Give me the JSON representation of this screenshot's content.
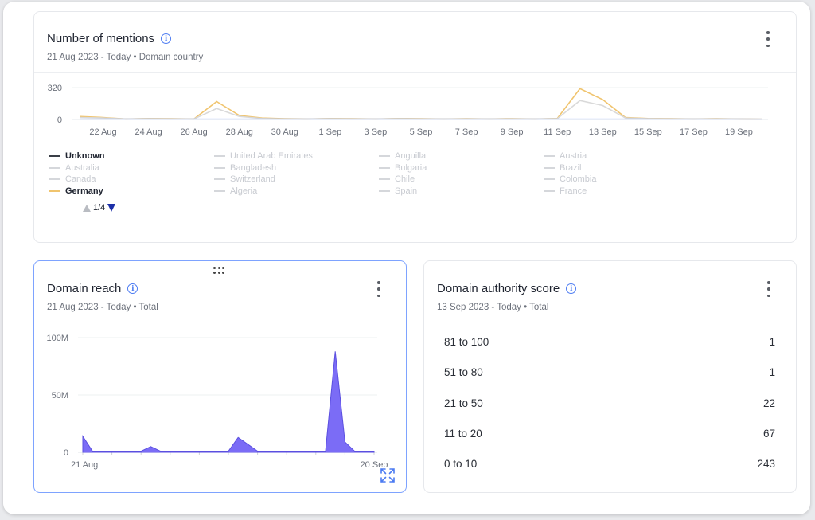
{
  "mentions": {
    "title": "Number of mentions",
    "subtitle": "21 Aug 2023 - Today • Domain country",
    "legend": [
      {
        "label": "Unknown",
        "state": "active"
      },
      {
        "label": "United Arab Emirates",
        "state": "inactive"
      },
      {
        "label": "Anguilla",
        "state": "inactive"
      },
      {
        "label": "Austria",
        "state": "inactive"
      },
      {
        "label": "Australia",
        "state": "inactive"
      },
      {
        "label": "Bangladesh",
        "state": "inactive"
      },
      {
        "label": "Bulgaria",
        "state": "inactive"
      },
      {
        "label": "Brazil",
        "state": "inactive"
      },
      {
        "label": "Canada",
        "state": "inactive"
      },
      {
        "label": "Switzerland",
        "state": "inactive"
      },
      {
        "label": "Chile",
        "state": "inactive"
      },
      {
        "label": "Colombia",
        "state": "inactive"
      },
      {
        "label": "Germany",
        "state": "active"
      },
      {
        "label": "Algeria",
        "state": "inactive"
      },
      {
        "label": "Spain",
        "state": "inactive"
      },
      {
        "label": "France",
        "state": "inactive"
      }
    ],
    "pager": "1/4"
  },
  "reach": {
    "title": "Domain reach",
    "subtitle": "21 Aug 2023 - Today • Total"
  },
  "authority": {
    "title": "Domain authority score",
    "subtitle": "13 Sep 2023 - Today • Total",
    "rows": [
      {
        "label": "81 to 100",
        "value": "1"
      },
      {
        "label": "51 to 80",
        "value": "1"
      },
      {
        "label": "21 to 50",
        "value": "22"
      },
      {
        "label": "11 to 20",
        "value": "67"
      },
      {
        "label": "0 to 10",
        "value": "243"
      }
    ]
  },
  "colors": {
    "germany": "#f0c46e",
    "unknown": "#d9d9d9",
    "reach_fill": "#7b6cf6",
    "accent": "#4d7cf2"
  },
  "chart_data": [
    {
      "type": "line",
      "ylim": [
        0,
        320
      ],
      "yticks": [
        "320",
        "0"
      ],
      "xticks": [
        "22 Aug",
        "24 Aug",
        "26 Aug",
        "28 Aug",
        "30 Aug",
        "1 Sep",
        "3 Sep",
        "5 Sep",
        "7 Sep",
        "9 Sep",
        "11 Sep",
        "13 Sep",
        "15 Sep",
        "17 Sep",
        "19 Sep"
      ],
      "x": [
        "21 Aug",
        "22 Aug",
        "23 Aug",
        "24 Aug",
        "25 Aug",
        "26 Aug",
        "27 Aug",
        "28 Aug",
        "29 Aug",
        "30 Aug",
        "31 Aug",
        "1 Sep",
        "2 Sep",
        "3 Sep",
        "4 Sep",
        "5 Sep",
        "6 Sep",
        "7 Sep",
        "8 Sep",
        "9 Sep",
        "10 Sep",
        "11 Sep",
        "12 Sep",
        "13 Sep",
        "14 Sep",
        "15 Sep",
        "16 Sep",
        "17 Sep",
        "18 Sep",
        "19 Sep",
        "20 Sep"
      ],
      "series": [
        {
          "name": "Germany",
          "values": [
            30,
            20,
            5,
            10,
            8,
            5,
            180,
            40,
            15,
            8,
            5,
            10,
            8,
            5,
            10,
            8,
            5,
            8,
            5,
            8,
            5,
            10,
            310,
            200,
            20,
            10,
            8,
            5,
            8,
            5,
            3
          ]
        },
        {
          "name": "Unknown",
          "values": [
            20,
            15,
            5,
            8,
            5,
            5,
            110,
            30,
            10,
            5,
            5,
            8,
            5,
            5,
            8,
            5,
            5,
            5,
            5,
            5,
            5,
            8,
            190,
            140,
            15,
            8,
            5,
            5,
            5,
            5,
            2
          ]
        }
      ]
    },
    {
      "type": "area",
      "ylim": [
        0,
        100
      ],
      "yticks": [
        "100M",
        "50M",
        "0"
      ],
      "xticks": [
        "21 Aug",
        "20 Sep"
      ],
      "x": [
        "21 Aug",
        "22 Aug",
        "23 Aug",
        "24 Aug",
        "25 Aug",
        "26 Aug",
        "27 Aug",
        "28 Aug",
        "29 Aug",
        "30 Aug",
        "31 Aug",
        "1 Sep",
        "2 Sep",
        "3 Sep",
        "4 Sep",
        "5 Sep",
        "6 Sep",
        "7 Sep",
        "8 Sep",
        "9 Sep",
        "10 Sep",
        "11 Sep",
        "12 Sep",
        "13 Sep",
        "14 Sep",
        "15 Sep",
        "16 Sep",
        "17 Sep",
        "18 Sep",
        "19 Sep",
        "20 Sep"
      ],
      "series": [
        {
          "values": [
            14,
            1,
            1,
            1,
            1,
            1,
            1,
            5,
            1,
            1,
            1,
            1,
            1,
            1,
            1,
            1,
            13,
            7,
            1,
            1,
            1,
            1,
            1,
            1,
            1,
            1,
            88,
            9,
            1,
            1,
            1
          ]
        }
      ]
    }
  ]
}
